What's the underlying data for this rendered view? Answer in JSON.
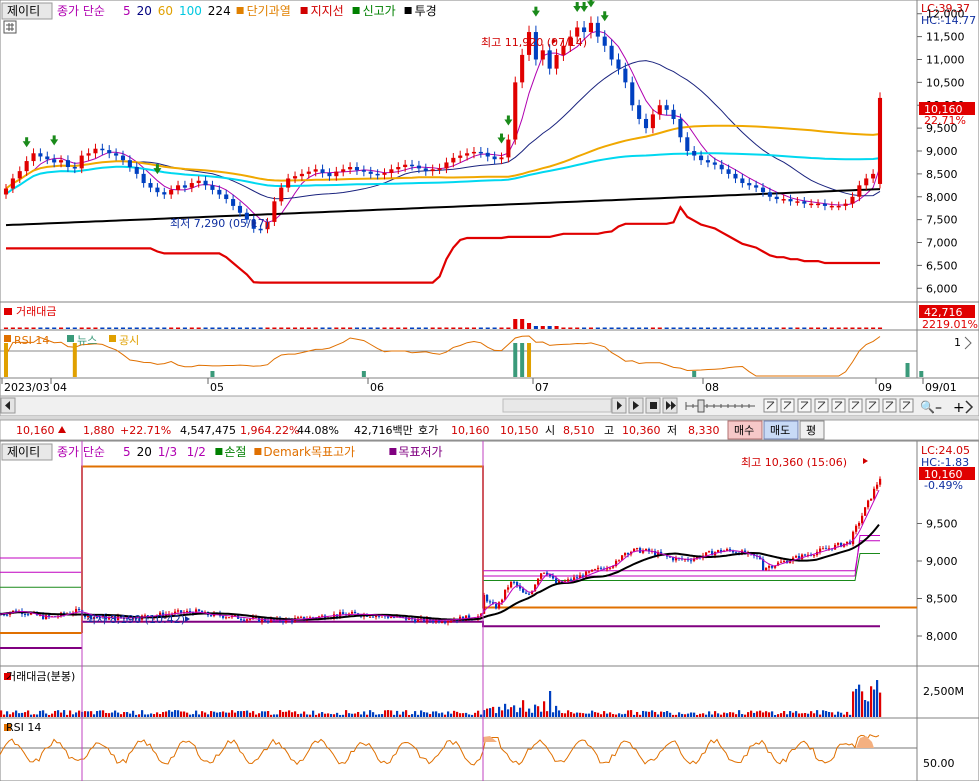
{
  "top_chart": {
    "stock_name": "제이티",
    "legend": [
      {
        "label": "종가 단순",
        "color": "#b000b0"
      },
      {
        "label": "5",
        "color": "#b000b0"
      },
      {
        "label": "20",
        "color": "#000080"
      },
      {
        "label": "60",
        "color": "#e0a000"
      },
      {
        "label": "100",
        "color": "#00c8e0"
      },
      {
        "label": "224",
        "color": "#000000"
      },
      {
        "label": "단기과열",
        "color": "#e08000"
      },
      {
        "label": "지지선",
        "color": "#d00000"
      },
      {
        "label": "신고가",
        "color": "#008000"
      },
      {
        "label": "투경",
        "color": "#000000"
      }
    ],
    "lc_label": "LC:39.37",
    "hc_label": "HC:-14.77",
    "price_axis": [
      "12,000",
      "11,500",
      "11,000",
      "10,500",
      "10,000",
      "9,500",
      "9,000",
      "8,500",
      "8,000",
      "7,500",
      "7,000",
      "6,500",
      "6,000"
    ],
    "price_tag": "10,160",
    "pct_tag": "22.71%",
    "high_annotation": "최고 11,920 (07/14)",
    "low_annotation": "최저 7,290 (05/17)",
    "volume_label": "거래대금",
    "volume_tag": "42,716",
    "volume_pct_tag": "2219.01%",
    "rsi_legend": [
      {
        "label": "RSI 14",
        "color": "#e07000"
      },
      {
        "label": "뉴스",
        "color": "#3a9a7a"
      },
      {
        "label": "공시",
        "color": "#e0a000"
      }
    ],
    "rsi_axis_tag": "1",
    "date_axis": [
      "2023/03",
      "04",
      "05",
      "06",
      "07",
      "08",
      "09",
      "09/01"
    ]
  },
  "top_price_data": {
    "type": "candlestick",
    "x_range": [
      0,
      135
    ],
    "y_range": [
      5700,
      12300
    ],
    "closes": [
      8180,
      8400,
      8560,
      8780,
      8950,
      8880,
      8820,
      8750,
      8800,
      8650,
      8620,
      8900,
      8950,
      9050,
      9020,
      8950,
      8900,
      8800,
      8650,
      8500,
      8300,
      8200,
      8100,
      8050,
      8150,
      8250,
      8200,
      8300,
      8350,
      8250,
      8150,
      8050,
      7950,
      7800,
      7650,
      7500,
      7300,
      7290,
      7450,
      7900,
      8200,
      8400,
      8450,
      8500,
      8550,
      8600,
      8520,
      8450,
      8550,
      8600,
      8650,
      8580,
      8550,
      8500,
      8480,
      8520,
      8600,
      8650,
      8700,
      8680,
      8620,
      8560,
      8600,
      8620,
      8750,
      8850,
      8900,
      8950,
      8980,
      8960,
      8880,
      8820,
      8860,
      9250,
      10500,
      11100,
      11600,
      11000,
      11200,
      10800,
      11100,
      11300,
      11500,
      11700,
      11600,
      11800,
      11500,
      11300,
      11000,
      10800,
      10500,
      10000,
      9700,
      9500,
      9800,
      10000,
      9900,
      9700,
      9300,
      9000,
      8900,
      8800,
      8750,
      8700,
      8600,
      8500,
      8400,
      8300,
      8250,
      8200,
      8100,
      8000,
      7950,
      7950,
      7900,
      7900,
      7850,
      7850,
      7850,
      7800,
      7800,
      7800,
      7850,
      8000,
      8250,
      8400,
      8500,
      10160
    ],
    "opens": [
      8050,
      8180,
      8400,
      8560,
      8780,
      8950,
      8880,
      8820,
      8750,
      8800,
      8650,
      8620,
      8900,
      8950,
      9050,
      9020,
      8950,
      8900,
      8800,
      8650,
      8500,
      8300,
      8200,
      8100,
      8050,
      8150,
      8250,
      8200,
      8300,
      8350,
      8250,
      8150,
      8050,
      7950,
      7800,
      7650,
      7500,
      7300,
      7290,
      7450,
      7900,
      8200,
      8400,
      8450,
      8500,
      8550,
      8600,
      8520,
      8450,
      8550,
      8600,
      8650,
      8580,
      8550,
      8500,
      8480,
      8520,
      8600,
      8650,
      8700,
      8680,
      8620,
      8560,
      8600,
      8620,
      8750,
      8850,
      8900,
      8950,
      8980,
      8960,
      8880,
      8820,
      8860,
      9250,
      10500,
      11100,
      11600,
      11000,
      11200,
      10800,
      11100,
      11300,
      11500,
      11700,
      11600,
      11800,
      11500,
      11300,
      11000,
      10800,
      10500,
      10000,
      9700,
      9500,
      9800,
      10000,
      9900,
      9700,
      9300,
      9000,
      8900,
      8800,
      8750,
      8700,
      8600,
      8500,
      8400,
      8300,
      8250,
      8200,
      8100,
      8000,
      7950,
      7950,
      7900,
      7900,
      7850,
      7850,
      7850,
      7800,
      7800,
      7800,
      7850,
      8000,
      8250,
      8400,
      8280
    ]
  },
  "order_bar": {
    "price": "10,160",
    "change": "1,880",
    "change_pct": "+22.71%",
    "volume": "4,547,475",
    "volume_pct": "1,964.22%",
    "turnover_pct": "44.08%",
    "amount": "42,716백만",
    "ask_label": "호가",
    "ask_sell": "10,160",
    "ask_buy": "10,150",
    "open_label": "시",
    "open": "8,510",
    "high_label": "고",
    "high": "10,360",
    "low_label": "저",
    "low": "8,330",
    "buy_button": "매수",
    "sell_button": "매도",
    "avg_button": "평"
  },
  "bottom_chart": {
    "stock_name": "제이티",
    "legend": [
      {
        "label": "종가 단순",
        "color": "#b000b0"
      },
      {
        "label": "5",
        "color": "#b000b0"
      },
      {
        "label": "20",
        "color": "#000000"
      },
      {
        "label": "1/3",
        "color": "#b000b0"
      },
      {
        "label": "1/2",
        "color": "#b000b0"
      },
      {
        "label": "손절",
        "color": "#008000"
      },
      {
        "label": "Demark목표고가",
        "color": "#e07000"
      },
      {
        "label": "목표저가",
        "color": "#800080"
      }
    ],
    "lc_label": "LC:24.05",
    "hc_label": "HC:-1.83",
    "price_axis": [
      "9,500",
      "9,000",
      "8,500",
      "8,000"
    ],
    "price_tag": "10,160",
    "pct_tag": "-0.49%",
    "high_annotation": "최고 10,360 (15:06)",
    "low_annotation": "최저 8,190 (10:42)",
    "volume_label": "거래대금(분봉)",
    "volume_axis_tag": "2,500M",
    "rsi_label": "RSI 14",
    "rsi_axis_tag": "50.00"
  },
  "colors": {
    "up": "#e00000",
    "down": "#0040c0",
    "panel_border": "#808080",
    "axis_bg": "#ffffff",
    "tag_red": "#e00000"
  },
  "icons": [
    "grid-icon",
    "scroll-left-icon",
    "scroll-right-icon",
    "play-icon",
    "stop-icon",
    "forward-icon",
    "zoom-out-icon",
    "zoom-in-icon"
  ]
}
